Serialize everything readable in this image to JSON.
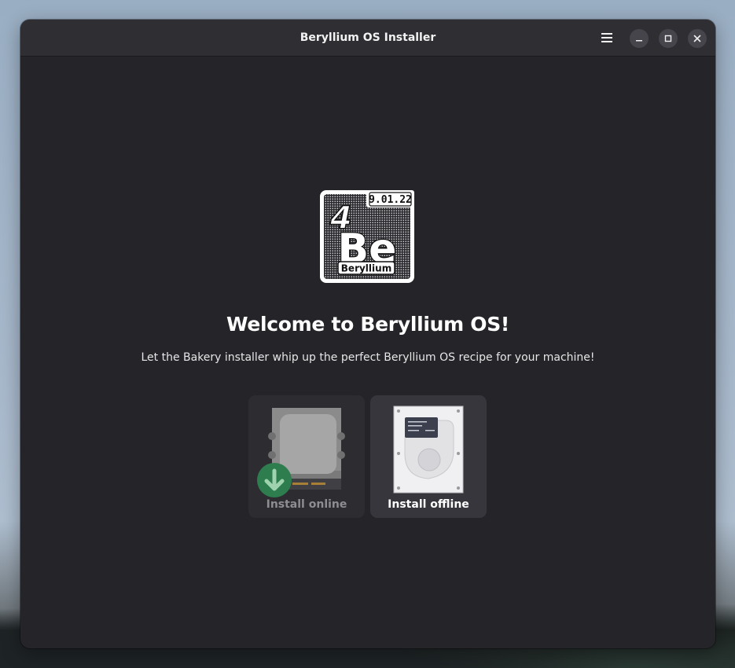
{
  "window": {
    "title": "Beryllium OS Installer",
    "controls": {
      "menu_icon": "hamburger-menu-icon",
      "minimize_icon": "minimize-icon",
      "maximize_icon": "maximize-icon",
      "close_icon": "close-icon"
    }
  },
  "logo": {
    "version": "9.01.22",
    "atomic_number": "4",
    "symbol": "Be",
    "name": "Beryllium"
  },
  "welcome": {
    "title": "Welcome to Beryllium OS!",
    "subtitle": "Let the Bakery installer whip up the perfect Beryllium OS recipe for your machine!"
  },
  "options": [
    {
      "label": "Install online",
      "icon": "download-drive-icon",
      "enabled": false
    },
    {
      "label": "Install offline",
      "icon": "hard-drive-icon",
      "enabled": true
    }
  ],
  "colors": {
    "window_bg": "#242429",
    "header_bg": "#2e2e33",
    "card_bg": "#36363c",
    "download_badge": "#2e7d4f"
  }
}
